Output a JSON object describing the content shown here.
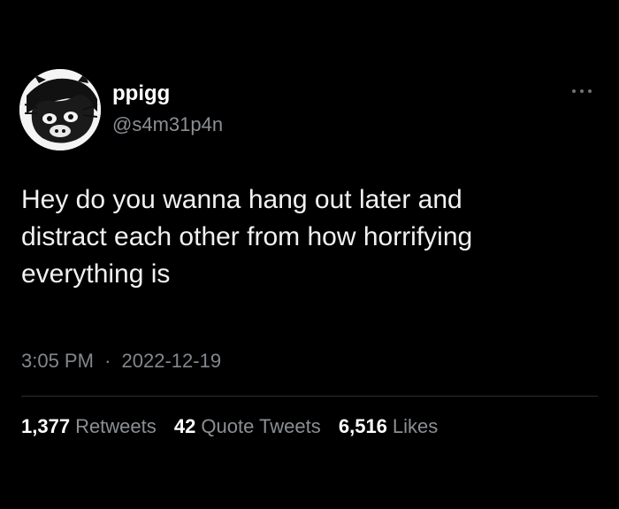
{
  "author": {
    "display_name": "ppigg",
    "handle": "@s4m31p4n",
    "avatar_icon": "pig-avatar-icon"
  },
  "more_icon": "more-options-icon",
  "tweet": {
    "lines": [
      "Hey do you wanna hang out later and",
      "distract each other from how horrifying",
      "everything is"
    ]
  },
  "meta": {
    "time": "3:05 PM",
    "separator": "·",
    "date": "2022-12-19"
  },
  "stats": {
    "retweets": {
      "count": "1,377",
      "label": "Retweets"
    },
    "quote_tweets": {
      "count": "42",
      "label": "Quote Tweets"
    },
    "likes": {
      "count": "6,516",
      "label": "Likes"
    }
  },
  "colors": {
    "background": "#000000",
    "primary_text": "#ffffff",
    "secondary_text": "#8b8f93",
    "divider": "#2a2d30"
  }
}
